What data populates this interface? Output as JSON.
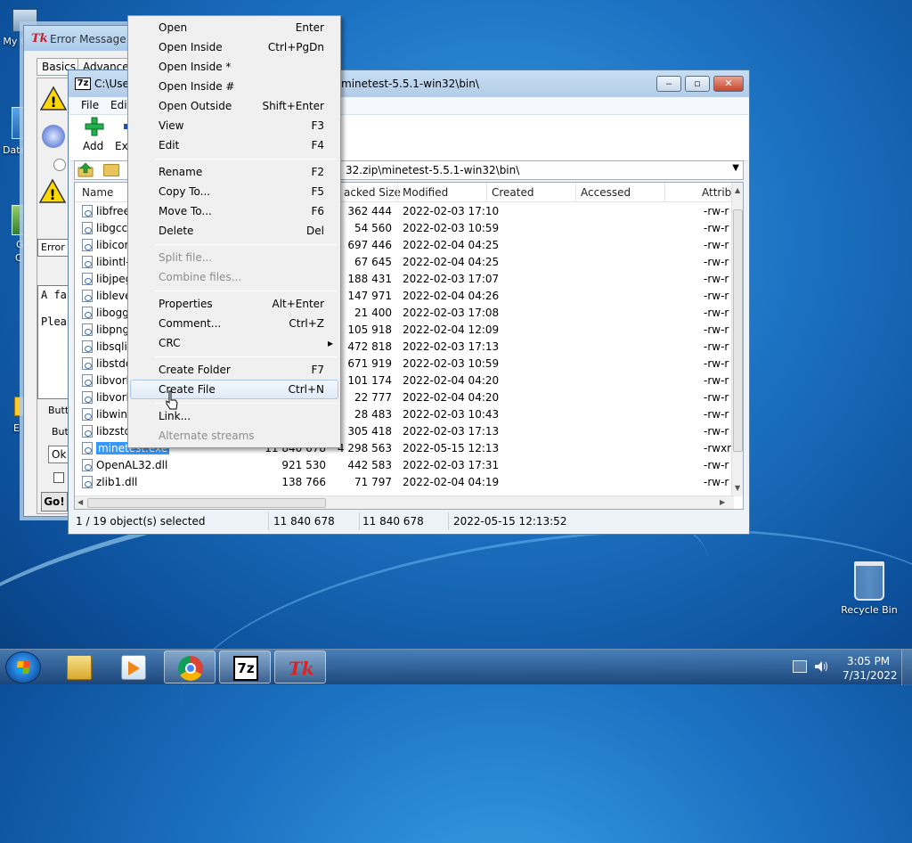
{
  "desktop": {
    "icons": {
      "my_computer": "My C",
      "recycle_bin": "Recycle Bin"
    },
    "left_fragments": [
      "Data",
      "G",
      "C",
      "E"
    ]
  },
  "tk_window": {
    "title": "Error Message Ge",
    "tabs": [
      "Basics",
      "Advanced"
    ],
    "title_field": "Error M",
    "message_line1": "A fa",
    "message_line2": "Plea",
    "buttons_group_label": "Butt",
    "button_label_field": "Butt",
    "button_text_value": "Ok",
    "go_button": "Go!"
  },
  "sevenzip": {
    "title_left": "C:\\User",
    "title_right": "minetest-5.5.1-win32\\bin\\",
    "menu": [
      "File",
      "Edit"
    ],
    "toolbar": {
      "add": "Add",
      "extract_fragment": "Ext"
    },
    "path": "32.zip\\minetest-5.5.1-win32\\bin\\",
    "columns": {
      "name": "Name",
      "packed": "acked Size",
      "modified": "Modified",
      "created": "Created",
      "accessed": "Accessed",
      "attrib": "Attrib"
    },
    "rows": [
      {
        "name": "libfreet",
        "size": "",
        "packed": "362 444",
        "modified": "2022-02-03 17:10",
        "attrib": "-rw-r"
      },
      {
        "name": "libgcc_",
        "size": "",
        "packed": "54 560",
        "modified": "2022-02-03 10:59",
        "attrib": "-rw-r"
      },
      {
        "name": "libicon",
        "size": "",
        "packed": "697 446",
        "modified": "2022-02-04 04:25",
        "attrib": "-rw-r"
      },
      {
        "name": "libintl-",
        "size": "",
        "packed": "67 645",
        "modified": "2022-02-04 04:25",
        "attrib": "-rw-r"
      },
      {
        "name": "libjpeg",
        "size": "",
        "packed": "188 431",
        "modified": "2022-02-03 17:07",
        "attrib": "-rw-r"
      },
      {
        "name": "libleve",
        "size": "",
        "packed": "147 971",
        "modified": "2022-02-04 04:26",
        "attrib": "-rw-r"
      },
      {
        "name": "libogg",
        "size": "",
        "packed": "21 400",
        "modified": "2022-02-03 17:08",
        "attrib": "-rw-r"
      },
      {
        "name": "libpng",
        "size": "",
        "packed": "105 918",
        "modified": "2022-02-04 12:09",
        "attrib": "-rw-r"
      },
      {
        "name": "libsqlit",
        "size": "",
        "packed": "472 818",
        "modified": "2022-02-03 17:13",
        "attrib": "-rw-r"
      },
      {
        "name": "libstdc",
        "size": "",
        "packed": "671 919",
        "modified": "2022-02-03 10:59",
        "attrib": "-rw-r"
      },
      {
        "name": "libvorb",
        "size": "",
        "packed": "101 174",
        "modified": "2022-02-04 04:20",
        "attrib": "-rw-r"
      },
      {
        "name": "libvorb",
        "size": "",
        "packed": "22 777",
        "modified": "2022-02-04 04:20",
        "attrib": "-rw-r"
      },
      {
        "name": "libwinp",
        "size": "",
        "packed": "28 483",
        "modified": "2022-02-03 10:43",
        "attrib": "-rw-r"
      },
      {
        "name": "libzstd",
        "size": "",
        "packed": "305 418",
        "modified": "2022-02-03 17:13",
        "attrib": "-rw-r"
      },
      {
        "name": "minetest.exe",
        "size": "11 840 678",
        "packed": "4 298 563",
        "modified": "2022-05-15 12:13",
        "attrib": "-rwxr",
        "selected": true
      },
      {
        "name": "OpenAL32.dll",
        "size": "921 530",
        "packed": "442 583",
        "modified": "2022-02-03 17:31",
        "attrib": "-rw-r"
      },
      {
        "name": "zlib1.dll",
        "size": "138 766",
        "packed": "71 797",
        "modified": "2022-02-04 04:19",
        "attrib": "-rw-r"
      }
    ],
    "status": {
      "selection": "1 / 19 object(s) selected",
      "size": "11 840 678",
      "packed": "11 840 678",
      "modified": "2022-05-15 12:13:52"
    }
  },
  "context_menu": {
    "items": [
      {
        "label": "Open",
        "shortcut": "Enter"
      },
      {
        "label": "Open Inside",
        "shortcut": "Ctrl+PgDn"
      },
      {
        "label": "Open Inside *",
        "shortcut": ""
      },
      {
        "label": "Open Inside #",
        "shortcut": ""
      },
      {
        "label": "Open Outside",
        "shortcut": "Shift+Enter"
      },
      {
        "label": "View",
        "shortcut": "F3"
      },
      {
        "label": "Edit",
        "shortcut": "F4"
      },
      {
        "label": "Rename",
        "shortcut": "F2"
      },
      {
        "label": "Copy To...",
        "shortcut": "F5"
      },
      {
        "label": "Move To...",
        "shortcut": "F6"
      },
      {
        "label": "Delete",
        "shortcut": "Del"
      },
      {
        "label": "Split file...",
        "shortcut": ""
      },
      {
        "label": "Combine files...",
        "shortcut": ""
      },
      {
        "label": "Properties",
        "shortcut": "Alt+Enter"
      },
      {
        "label": "Comment...",
        "shortcut": "Ctrl+Z"
      },
      {
        "label": "CRC",
        "shortcut": "▸"
      },
      {
        "label": "Create Folder",
        "shortcut": "F7"
      },
      {
        "label": "Create File",
        "shortcut": "Ctrl+N"
      },
      {
        "label": "Link...",
        "shortcut": ""
      },
      {
        "label": "Alternate streams",
        "shortcut": ""
      }
    ]
  },
  "taskbar": {
    "items": [
      "file-explorer-icon",
      "media-player-icon",
      "chrome-icon",
      "7zip-icon",
      "tk-icon"
    ],
    "sevenzip_label": "7z",
    "tk_label": "Tk",
    "clock_time": "3:05 PM",
    "clock_date": "7/31/2022"
  },
  "colors": {
    "selection": "#3399ff",
    "titlebar": "#b9d1ea",
    "desktop": "#1d74c4"
  }
}
